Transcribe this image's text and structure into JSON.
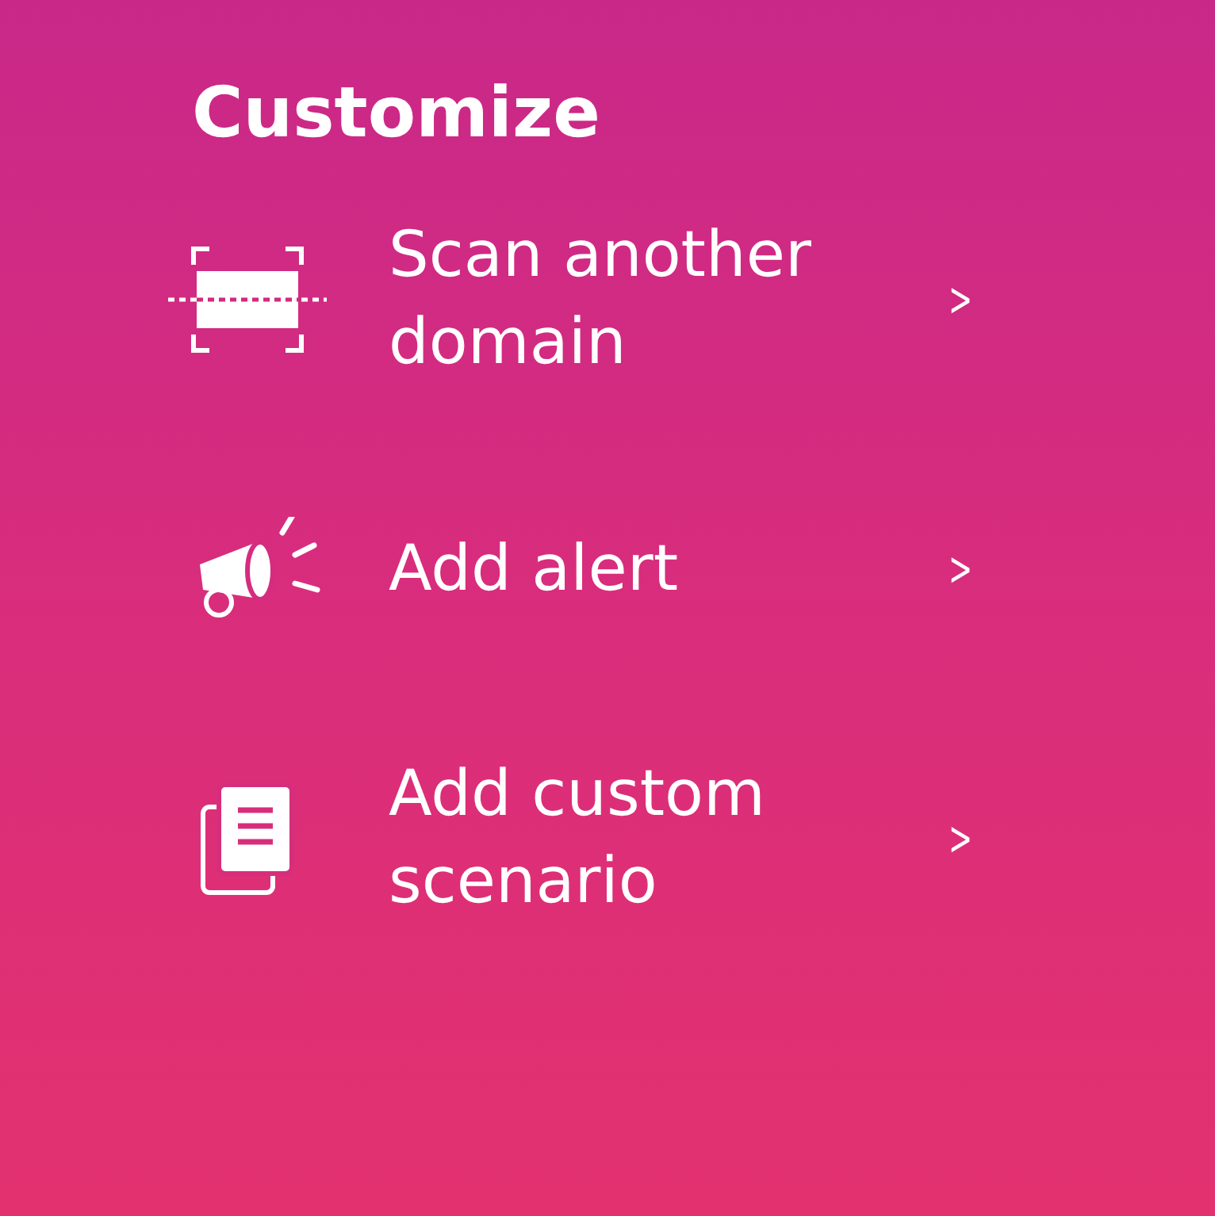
{
  "title": "Customize",
  "items": [
    {
      "kind": "scan",
      "label": "Scan another domain",
      "chevron": ">"
    },
    {
      "kind": "alert",
      "label": "Add alert",
      "chevron": ">"
    },
    {
      "kind": "scenario",
      "label": "Add custom scenario",
      "chevron": ">"
    }
  ]
}
